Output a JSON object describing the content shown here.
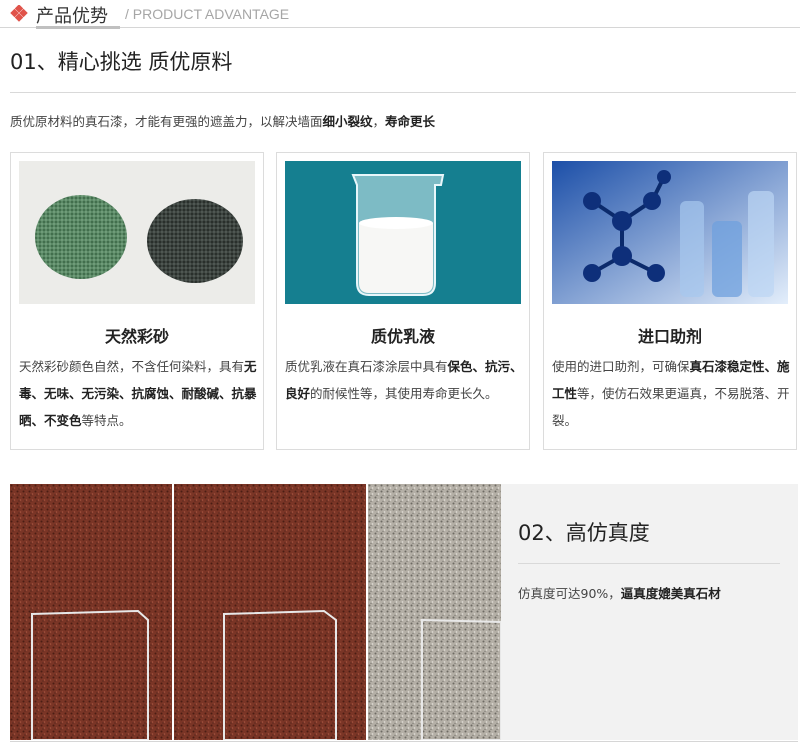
{
  "header": {
    "title_cn": "产品优势",
    "title_en": "/ PRODUCT ADVANTAGE",
    "icon": "diamond-cluster-icon",
    "accent_color": "#e0534a"
  },
  "section1": {
    "heading": "01、精心挑选 质优原料",
    "intro_plain": "质优原材料的真石漆，才能有更强的遮盖力，以解决墙面",
    "intro_bold1": "细小裂纹",
    "intro_sep": "，",
    "intro_bold2": "寿命更长"
  },
  "cards": [
    {
      "title": "天然彩砂",
      "image": "sand-piles-image",
      "d1": "天然彩砂颜色自然，不含任何染料，具有",
      "d2": "无毒、无味、无污染、抗腐蚀、耐酸碱、抗暴晒、不变色",
      "d3": "等特点。"
    },
    {
      "title": "质优乳液",
      "image": "beaker-emulsion-image",
      "d1": "质优乳液在真石漆涂层中具有",
      "d2": "保色、抗污、良好",
      "d3": "的耐候性等，其使用寿命更长久。"
    },
    {
      "title": "进口助剂",
      "image": "lab-glassware-image",
      "d1": "使用的进口助剂，可确保",
      "d2": "真石漆稳定性、施工性",
      "d3": "等，使仿石效果更逼真，不易脱落、开裂。"
    }
  ],
  "section2": {
    "heading": "02、高仿真度",
    "desc_plain": "仿真度可达90%，",
    "desc_bold": "逼真度媲美真石材"
  }
}
